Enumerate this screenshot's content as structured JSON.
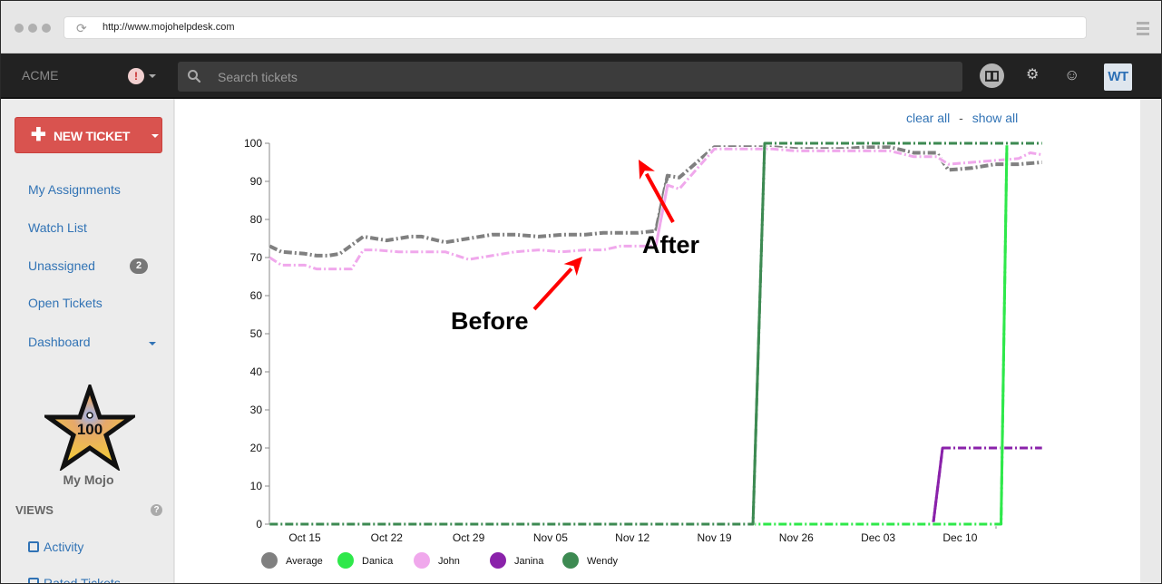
{
  "browser": {
    "url": "http://www.mojohelpdesk.com"
  },
  "topnav": {
    "brand": "ACME",
    "alert_icon": "exclamation-icon",
    "search_placeholder": "Search tickets",
    "avatar_initials": "WT",
    "colors": {
      "bar": "#222222",
      "avatar_text": "#2c6fb5"
    }
  },
  "sidebar": {
    "new_ticket_label": "NEW TICKET",
    "new_ticket_color": "#d9534f",
    "items": [
      {
        "label": "My Assignments"
      },
      {
        "label": "Watch List"
      },
      {
        "label": "Unassigned",
        "badge": "2"
      },
      {
        "label": "Open Tickets"
      },
      {
        "label": "Dashboard"
      }
    ],
    "mojo": {
      "score": "100",
      "label": "My Mojo"
    },
    "views_heading": "VIEWS",
    "views": [
      {
        "label": "Activity"
      },
      {
        "label": "Rated Tickets"
      }
    ]
  },
  "main": {
    "clear_all": "clear all",
    "separator": "-",
    "show_all": "show all",
    "annotations": {
      "before": "Before",
      "after": "After"
    }
  },
  "chart_data": {
    "type": "line",
    "title": "",
    "xlabel": "",
    "ylabel": "",
    "ylim": [
      0,
      100
    ],
    "yticks": [
      "0",
      "10",
      "20",
      "30",
      "40",
      "50",
      "60",
      "70",
      "80",
      "90",
      "100"
    ],
    "xticks": [
      "Oct 15",
      "Oct 22",
      "Oct 29",
      "Nov 05",
      "Nov 12",
      "Nov 19",
      "Nov 26",
      "Dec 03",
      "Dec 10"
    ],
    "x_day_offsets_from_oct15": [
      -3,
      -2,
      0,
      1,
      2,
      3,
      5,
      6,
      7,
      8,
      9,
      10,
      11,
      12,
      13,
      14,
      15,
      16,
      17,
      18,
      19,
      20,
      21,
      22,
      23,
      24,
      25,
      26,
      27,
      28,
      29,
      30,
      31,
      32,
      33,
      34,
      35,
      36,
      37,
      38,
      39,
      40,
      41,
      42,
      43,
      44,
      45,
      46,
      47,
      48,
      49,
      50,
      51,
      52,
      53,
      54,
      55,
      56,
      57,
      58
    ],
    "series": [
      {
        "name": "Average",
        "color": "#808080",
        "points": [
          [
            -3,
            73
          ],
          [
            -2,
            71.5
          ],
          [
            0,
            71
          ],
          [
            1,
            70.5
          ],
          [
            2,
            70.5
          ],
          [
            3,
            71
          ],
          [
            5,
            75.5
          ],
          [
            6,
            75
          ],
          [
            7,
            74.5
          ],
          [
            9,
            75.5
          ],
          [
            10,
            75.5
          ],
          [
            12,
            74
          ],
          [
            14,
            75
          ],
          [
            16,
            76
          ],
          [
            18,
            76
          ],
          [
            20,
            75.5
          ],
          [
            22,
            76
          ],
          [
            24,
            76
          ],
          [
            25.5,
            76.5
          ],
          [
            27,
            76.5
          ],
          [
            28.5,
            76.5
          ],
          [
            30,
            77
          ],
          [
            31,
            91.5
          ],
          [
            32,
            91
          ],
          [
            35,
            99
          ],
          [
            37,
            99
          ],
          [
            40,
            99
          ],
          [
            42,
            98.5
          ],
          [
            44,
            98.5
          ],
          [
            46,
            98.5
          ],
          [
            48,
            99
          ],
          [
            50,
            99
          ],
          [
            52,
            97.5
          ],
          [
            54,
            97.5
          ],
          [
            55,
            93
          ],
          [
            57,
            93.5
          ],
          [
            59,
            94.5
          ],
          [
            61,
            94.5
          ],
          [
            63,
            95
          ]
        ]
      },
      {
        "name": "Danica",
        "color": "#2ee84a",
        "points": [
          [
            -3,
            0
          ],
          [
            54,
            0
          ],
          [
            56,
            0
          ],
          [
            58,
            0
          ],
          [
            59.5,
            0
          ],
          [
            60,
            100
          ],
          [
            63,
            100
          ]
        ]
      },
      {
        "name": "John",
        "color": "#f0a8ec",
        "points": [
          [
            -3,
            70
          ],
          [
            -2,
            68
          ],
          [
            0,
            68
          ],
          [
            1,
            67
          ],
          [
            3,
            67
          ],
          [
            4,
            67
          ],
          [
            5,
            72
          ],
          [
            6,
            72
          ],
          [
            8,
            71.5
          ],
          [
            10,
            71.5
          ],
          [
            12,
            71.5
          ],
          [
            14,
            69.5
          ],
          [
            16,
            70.5
          ],
          [
            18,
            71.5
          ],
          [
            20,
            72
          ],
          [
            22,
            71.5
          ],
          [
            24,
            72
          ],
          [
            25.5,
            72
          ],
          [
            27,
            73
          ],
          [
            28.5,
            73
          ],
          [
            30,
            73
          ],
          [
            31,
            89
          ],
          [
            32,
            88
          ],
          [
            35,
            98.5
          ],
          [
            37,
            98.5
          ],
          [
            40,
            98.5
          ],
          [
            42,
            98
          ],
          [
            44,
            98
          ],
          [
            46,
            98
          ],
          [
            48,
            98
          ],
          [
            50,
            98
          ],
          [
            52,
            96.5
          ],
          [
            54,
            96.5
          ],
          [
            55,
            94.5
          ],
          [
            57,
            95
          ],
          [
            59,
            95.5
          ],
          [
            61,
            96
          ],
          [
            62,
            97.5
          ],
          [
            63,
            97
          ]
        ]
      },
      {
        "name": "Janina",
        "color": "#8a22aa",
        "points": [
          [
            -3,
            0
          ],
          [
            41,
            0
          ],
          [
            53,
            0
          ],
          [
            53.7,
            0
          ],
          [
            54.5,
            20
          ],
          [
            63,
            20
          ]
        ]
      },
      {
        "name": "Wendy",
        "color": "#3d8a52",
        "points": [
          [
            -3,
            0
          ],
          [
            38,
            0
          ],
          [
            38.3,
            0
          ],
          [
            39.3,
            100
          ],
          [
            63,
            100
          ]
        ]
      }
    ],
    "legend": {
      "position": "bottom-left",
      "entries": [
        "Average",
        "Danica",
        "John",
        "Janina",
        "Wendy"
      ]
    },
    "annotations": [
      {
        "text": "Before",
        "points_to_day_offset": 30,
        "points_to_value": 73
      },
      {
        "text": "After",
        "points_to_day_offset": 35,
        "points_to_value": 99
      }
    ],
    "grid": false
  }
}
